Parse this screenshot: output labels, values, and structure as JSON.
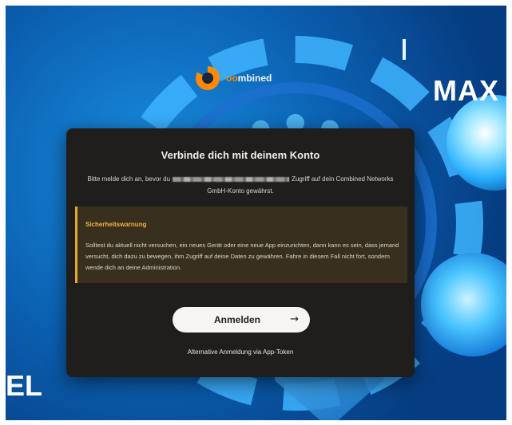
{
  "brand": {
    "name_prefix": "oo",
    "name_suffix": "mbined"
  },
  "background": {
    "text_right": "MAX",
    "text_left": "EL"
  },
  "dialog": {
    "title": "Verbinde dich mit deinem Konto",
    "description_before": "Bitte melde dich an, bevor du",
    "description_after": "Zugriff auf dein Combined Networks GmbH-Konto gewährst.",
    "warning": {
      "title": "Sicherheitswarnung",
      "text": "Solltest du aktuell nicht versuchen, ein neues Gerät oder eine neue App einzurichten, dann kann es sein, dass jemand versucht, dich dazu zu bewegen, ihm Zugriff auf deine Daten zu gewähren. Fahre in diesem Fall nicht fort, sondern wende dich an deine Administration."
    },
    "login_button_label": "Anmelden",
    "alt_login_label": "Alternative Anmeldung via App-Token"
  },
  "colors": {
    "accent_warning": "#e0a82e",
    "card_background": "#1f1e1d",
    "brand_orange": "#ff8a00"
  },
  "icons": {
    "login_arrow": "arrow-right-icon",
    "brand_logo": "combined-logo-icon"
  }
}
